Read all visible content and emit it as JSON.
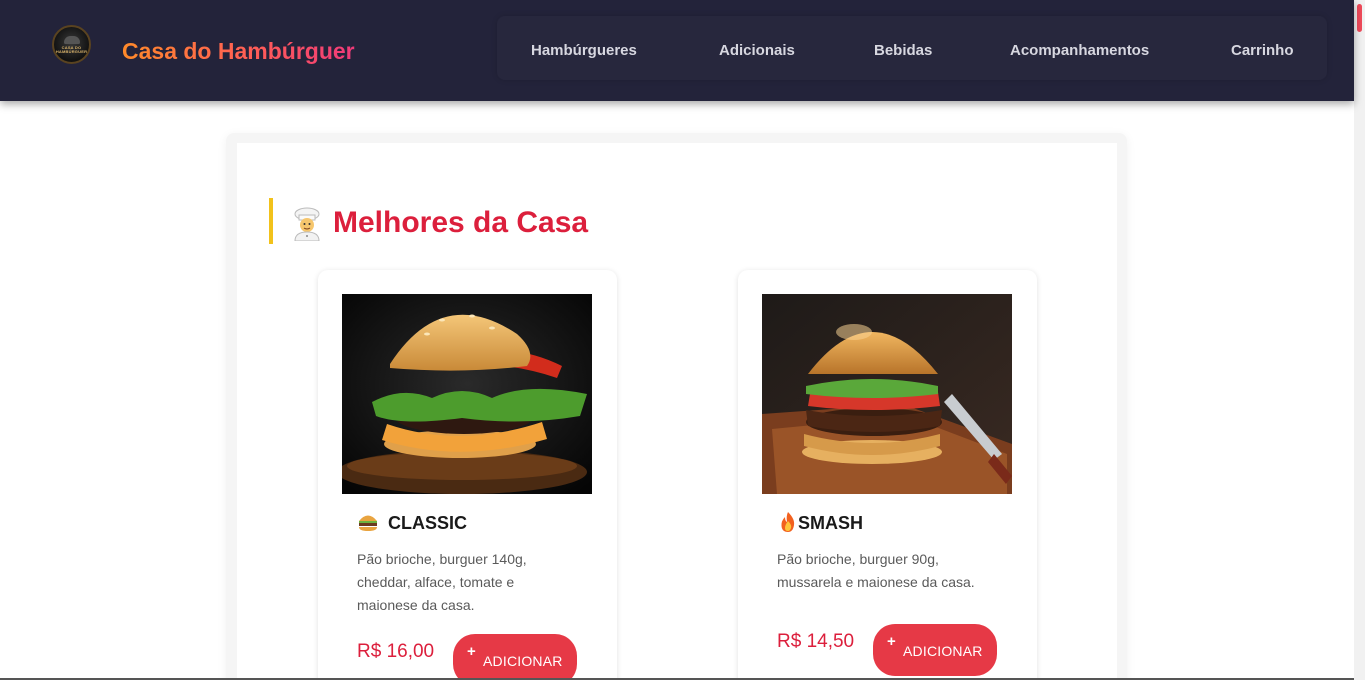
{
  "header": {
    "brand": "Casa do Hambúrguer",
    "logo_text": "CASA DO HAMBÚRGUER",
    "nav": [
      {
        "label": "Hambúrgueres"
      },
      {
        "label": "Adicionais"
      },
      {
        "label": "Bebidas"
      },
      {
        "label": "Acompanhamentos"
      },
      {
        "label": "Carrinho"
      }
    ]
  },
  "section": {
    "title": "Melhores da Casa",
    "icon": "chef-icon"
  },
  "products": [
    {
      "name": "CLASSIC",
      "icon": "burger-icon",
      "description": "Pão brioche, burguer 140g, cheddar, alface, tomate e maionese da casa.",
      "price": "R$ 16,00",
      "button_plus": "+",
      "button_label": "ADICIONAR"
    },
    {
      "name": "SMASH",
      "icon": "fire-icon",
      "description": "Pão brioche, burguer 90g, mussarela e maionese da casa.",
      "price": "R$ 14,50",
      "button_plus": "+",
      "button_label": "ADICIONAR"
    }
  ],
  "colors": {
    "navbar": "#23233a",
    "accent": "#dc1f3c",
    "button": "#e63946",
    "section_bar": "#f2c21b"
  }
}
